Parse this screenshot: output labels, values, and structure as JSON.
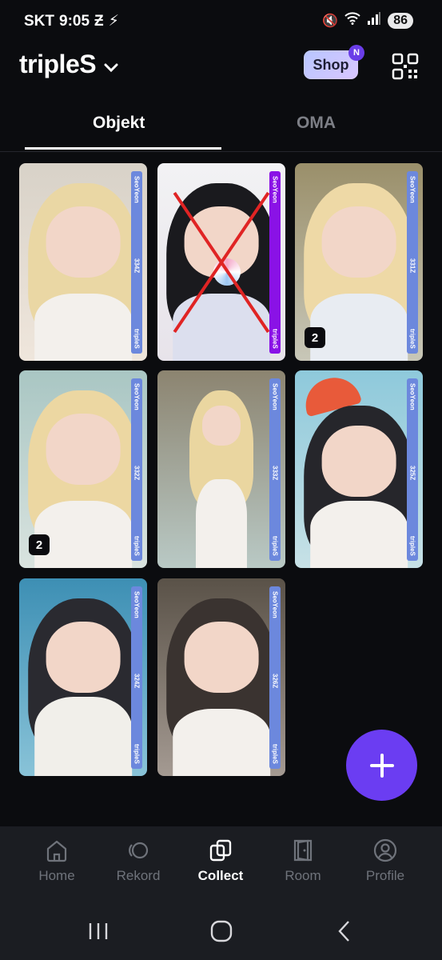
{
  "status": {
    "carrier": "SKT",
    "time": "9:05",
    "battery": "86"
  },
  "header": {
    "brand": "tripleS",
    "shop_label": "Shop",
    "shop_badge": "N"
  },
  "tabs": [
    {
      "label": "Objekt",
      "active": true
    },
    {
      "label": "OMA",
      "active": false
    }
  ],
  "cards": [
    {
      "member": "SeoYeon",
      "serial": "334Z",
      "group": "tripleS",
      "count": "",
      "crossed": false,
      "stripColor": "#6c88dd"
    },
    {
      "member": "SeoYeon",
      "serial": "",
      "group": "tripleS",
      "count": "",
      "crossed": true,
      "stripColor": "#8a12e6"
    },
    {
      "member": "SeoYeon",
      "serial": "331Z",
      "group": "tripleS",
      "count": "2",
      "crossed": false,
      "stripColor": "#6c88dd"
    },
    {
      "member": "SeoYeon",
      "serial": "332Z",
      "group": "tripleS",
      "count": "2",
      "crossed": false,
      "stripColor": "#6c88dd"
    },
    {
      "member": "SeoYeon",
      "serial": "333Z",
      "group": "tripleS",
      "count": "",
      "crossed": false,
      "stripColor": "#6c88dd"
    },
    {
      "member": "SeoYeon",
      "serial": "325Z",
      "group": "tripleS",
      "count": "",
      "crossed": false,
      "stripColor": "#6c88dd"
    },
    {
      "member": "SeoYeon",
      "serial": "324Z",
      "group": "tripleS",
      "count": "",
      "crossed": false,
      "stripColor": "#6c88dd"
    },
    {
      "member": "SeoYeon",
      "serial": "326Z",
      "group": "tripleS",
      "count": "",
      "crossed": false,
      "stripColor": "#6c88dd"
    }
  ],
  "nav": [
    {
      "label": "Home",
      "icon": "home-icon",
      "active": false
    },
    {
      "label": "Rekord",
      "icon": "rekord-icon",
      "active": false
    },
    {
      "label": "Collect",
      "icon": "collect-icon",
      "active": true
    },
    {
      "label": "Room",
      "icon": "room-icon",
      "active": false
    },
    {
      "label": "Profile",
      "icon": "profile-icon",
      "active": false
    }
  ],
  "colors": {
    "accent": "#6b3df2",
    "background": "#0b0c0f",
    "nav_bg": "#1b1d22"
  }
}
